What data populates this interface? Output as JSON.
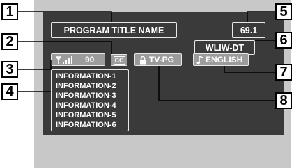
{
  "osd": {
    "program_title": "PROGRAM TITLE NAME",
    "channel_number": "69.1",
    "station_name": "WLIW-DT",
    "signal_strength": "90",
    "signal_icon": "antenna-signal-icon",
    "cc_label": "CC",
    "rating_icon": "lock-icon",
    "rating": "TV-PG",
    "audio_icon": "music-note-icon",
    "audio_language": "ENGLISH",
    "information": [
      "INFORMATION-1",
      "INFORMATION-2",
      "INFORMATION-3",
      "INFORMATION-4",
      "INFORMATION-5",
      "INFORMATION-6"
    ]
  },
  "callouts": [
    "1",
    "2",
    "3",
    "4",
    "5",
    "6",
    "7",
    "8"
  ]
}
